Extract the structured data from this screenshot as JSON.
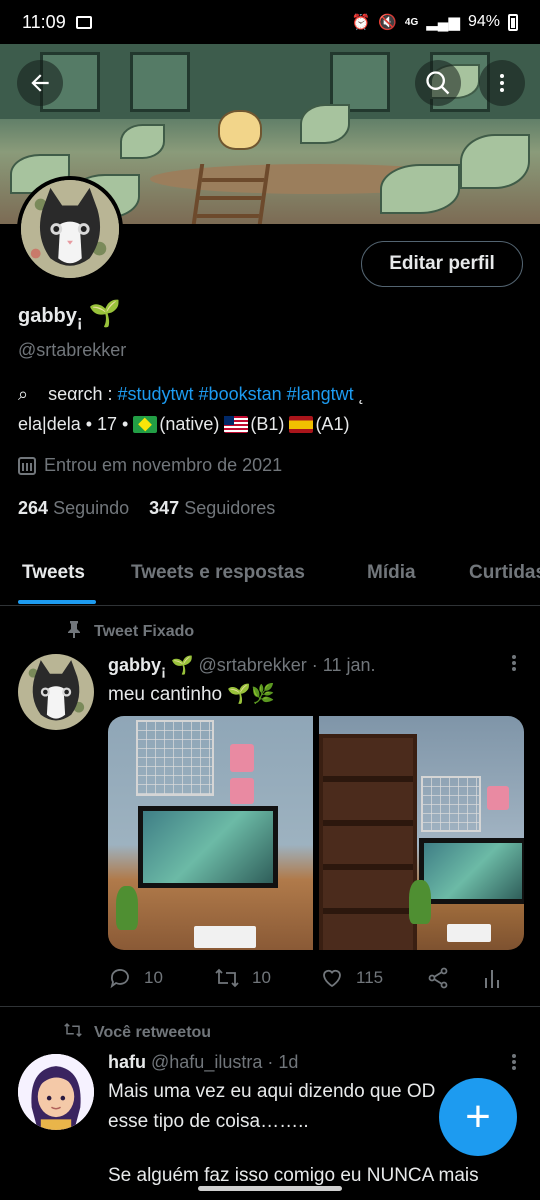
{
  "status_bar": {
    "time": "11:09",
    "battery": "94%",
    "network": "4G"
  },
  "header": {
    "back_icon": "arrow-left-icon",
    "search_icon": "search-icon",
    "more_icon": "more-vertical-icon"
  },
  "profile": {
    "display_name": "gabby",
    "name_suffix": "¡",
    "handle": "@srtabrekker",
    "edit_button": "Editar perfil",
    "bio_line1_prefix": "⌕    seαrch : ",
    "bio_hashtags": "#studytwt #bookstan #langtwt",
    "bio_line1_suffix": " ˛",
    "bio_line2_start": "ela|dela • 17 • ",
    "lang_native": "(native)",
    "lang_b1": "(B1)",
    "lang_a1": "(A1)",
    "joined": "Entrou em novembro de 2021",
    "following_count": "264",
    "following_label": "Seguindo",
    "followers_count": "347",
    "followers_label": "Seguidores"
  },
  "tabs": [
    "Tweets",
    "Tweets e respostas",
    "Mídia",
    "Curtidas"
  ],
  "tweets": [
    {
      "context": "Tweet Fixado",
      "name": "gabby",
      "name_suffix": "¡",
      "handle": "@srtabrekker",
      "time": "· 11 jan.",
      "text": "meu cantinho 🌱🌿",
      "replies": "10",
      "retweets": "10",
      "likes": "115"
    },
    {
      "context": "Você retweetou",
      "name": "hafu",
      "handle": "@hafu_ilustra",
      "time": "· 1d",
      "text_line1": "Mais uma vez eu aqui dizendo que OD",
      "text_line2": "esse tipo de coisa……..",
      "text_line3": "Se alguém faz isso comigo eu NUNCA mais"
    }
  ],
  "fab_label": "+"
}
